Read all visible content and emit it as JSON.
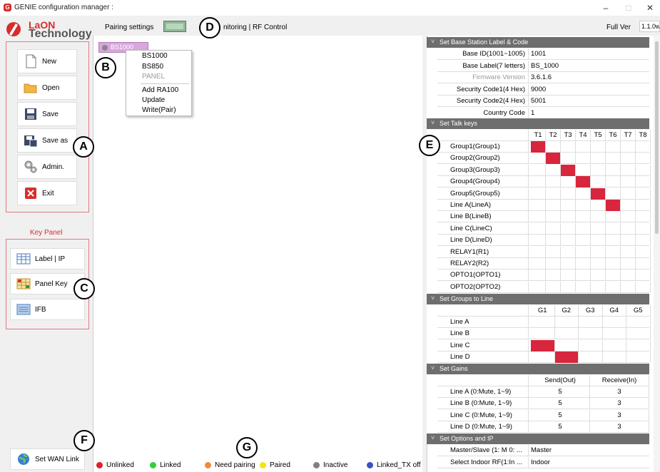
{
  "window": {
    "title": "GENIE configuration manager :",
    "icon_letter": "G",
    "minimize": "–",
    "maximize": "□",
    "close": "✕"
  },
  "logo": {
    "line1": "LaON",
    "line2": "Technology"
  },
  "topbar": {
    "pairing_settings": "Pairing settings",
    "monitoring": "nitoring | RF Control",
    "full_ver": "Full  Ver",
    "version": "1.1.0w"
  },
  "file_buttons": [
    {
      "label": "New",
      "icon": "new-file-icon"
    },
    {
      "label": "Open",
      "icon": "folder-icon"
    },
    {
      "label": "Save",
      "icon": "floppy-icon"
    },
    {
      "label": "Save as",
      "icon": "floppy-save-as-icon"
    },
    {
      "label": "Admin.",
      "icon": "gears-icon"
    },
    {
      "label": "Exit",
      "icon": "exit-icon"
    }
  ],
  "key_panel": {
    "title": "Key Panel",
    "buttons": [
      {
        "label": "Label | IP",
        "icon": "table-icon"
      },
      {
        "label": "Panel Key",
        "icon": "grid-icon"
      },
      {
        "label": "IFB",
        "icon": "list-icon"
      }
    ]
  },
  "wan_button": {
    "label": "Set WAN Link",
    "icon": "globe-icon"
  },
  "node": {
    "label": "BS1000"
  },
  "context_menu": {
    "items": [
      "BS1000",
      "BS850",
      "PANEL",
      "Add RA100",
      "Update",
      "Write(Pair)"
    ]
  },
  "markers": {
    "a": "A",
    "b": "B",
    "c": "C",
    "d": "D",
    "e": "E",
    "f": "F",
    "g": "G"
  },
  "sections": {
    "base": "Set Base Station Label & Code",
    "talk": "Set Talk keys",
    "groups": "Set Groups to Line",
    "gains": "Set Gains",
    "options": "Set Options and IP"
  },
  "base_rows": [
    {
      "label": "Base ID(1001~1005)",
      "value": "1001"
    },
    {
      "label": "Base Label(7 letters)",
      "value": "BS_1000"
    },
    {
      "label": "Firmware Version",
      "value": "3.6.1.6"
    },
    {
      "label": "Security Code1(4 Hex)",
      "value": "9000"
    },
    {
      "label": "Security Code2(4 Hex)",
      "value": "5001"
    },
    {
      "label": "Country Code",
      "value": "1"
    }
  ],
  "talk_columns": [
    "T1",
    "T2",
    "T3",
    "T4",
    "T5",
    "T6",
    "T7",
    "T8"
  ],
  "talk_rows": [
    {
      "label": "Group1(Group1)",
      "active": 0
    },
    {
      "label": "Group2(Group2)",
      "active": 1
    },
    {
      "label": "Group3(Group3)",
      "active": 2
    },
    {
      "label": "Group4(Group4)",
      "active": 3
    },
    {
      "label": "Group5(Group5)",
      "active": 4
    },
    {
      "label": "Line A(LineA)",
      "active": 5
    },
    {
      "label": "Line B(LineB)",
      "active": -1
    },
    {
      "label": "Line C(LineC)",
      "active": -1
    },
    {
      "label": "Line D(LineD)",
      "active": -1
    },
    {
      "label": "RELAY1(R1)",
      "active": -1
    },
    {
      "label": "RELAY2(R2)",
      "active": -1
    },
    {
      "label": "OPTO1(OPTO1)",
      "active": -1
    },
    {
      "label": "OPTO2(OPTO2)",
      "active": -1
    }
  ],
  "group_columns": [
    "G1",
    "G2",
    "G3",
    "G4",
    "G5"
  ],
  "group_rows": [
    {
      "label": "Line A",
      "active": -1
    },
    {
      "label": "Line B",
      "active": -1
    },
    {
      "label": "Line C",
      "active": 0
    },
    {
      "label": "Line D",
      "active": 1
    }
  ],
  "gain_columns": [
    "Send(Out)",
    "Receive(In)"
  ],
  "gain_rows": [
    {
      "label": "Line A (0:Mute, 1~9)",
      "send": "5",
      "receive": "3"
    },
    {
      "label": "Line B (0:Mute, 1~9)",
      "send": "5",
      "receive": "3"
    },
    {
      "label": "Line C (0:Mute, 1~9)",
      "send": "5",
      "receive": "3"
    },
    {
      "label": "Line D (0:Mute, 1~9)",
      "send": "5",
      "receive": "3"
    }
  ],
  "option_rows": [
    {
      "label": "Master/Slave (1: M 0: ...",
      "value": "Master"
    },
    {
      "label": "Select Indoor RF(1:In ...",
      "value": "Indoor"
    }
  ],
  "legend": [
    {
      "label": "Unlinked",
      "color": "#e0202a"
    },
    {
      "label": "Linked",
      "color": "#2fd13a"
    },
    {
      "label": "Need pairing",
      "color": "#f08a3c"
    },
    {
      "label": "Paired",
      "color": "#f2e31a"
    },
    {
      "label": "Inactive",
      "color": "#808080"
    },
    {
      "label": "Linked_TX off",
      "color": "#3c50c8"
    }
  ],
  "colors": {
    "accent": "#d62d2d",
    "active_cell": "#d7263d",
    "section_header": "#6e6e6e"
  }
}
